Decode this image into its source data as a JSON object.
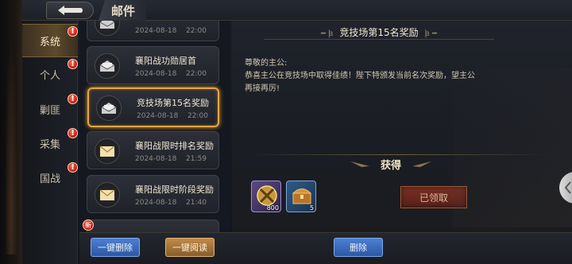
{
  "header": {
    "title": "邮件"
  },
  "sidebar": {
    "tabs": [
      {
        "label": "系统",
        "badge": "!"
      },
      {
        "label": "个人",
        "badge": "!"
      },
      {
        "label": "剿匪",
        "badge": "!"
      },
      {
        "label": "采集",
        "badge": "!"
      },
      {
        "label": "国战",
        "badge": "!"
      }
    ]
  },
  "mails": [
    {
      "title": "",
      "date": "2024-08-18",
      "time": "22:00"
    },
    {
      "title": "襄阳战功勋居首",
      "date": "2024-08-18",
      "time": "22:00"
    },
    {
      "title": "竞技场第15名奖励",
      "date": "2024-08-18",
      "time": "22:00"
    },
    {
      "title": "襄阳战限时排名奖励",
      "date": "2024-08-18",
      "time": "21:59"
    },
    {
      "title": "襄阳战限时阶段奖励",
      "date": "2024-08-18",
      "time": "21:40"
    }
  ],
  "new_badge": "新",
  "detail": {
    "title": "竞技场第15名奖励",
    "greeting": "尊敬的主公:",
    "body": "恭喜主公在竞技场中取得佳绩！陛下特颁发当前名次奖励，望主公再接再厉!",
    "reward_label": "获得",
    "rewards": [
      {
        "icon": "crossed-swords-coin-icon",
        "quantity": "800"
      },
      {
        "icon": "treasure-chest-icon",
        "quantity": "5"
      }
    ],
    "claimed_label": "已领取"
  },
  "footer": {
    "delete_all": "一键删除",
    "read_all": "一键阅读",
    "delete": "删除"
  },
  "colors": {
    "selected_border": "#e7a640",
    "button_blue": "#3b6cc0",
    "button_gold": "#a9753a",
    "claimed": "#6a281f",
    "badge_red": "#d42218"
  }
}
